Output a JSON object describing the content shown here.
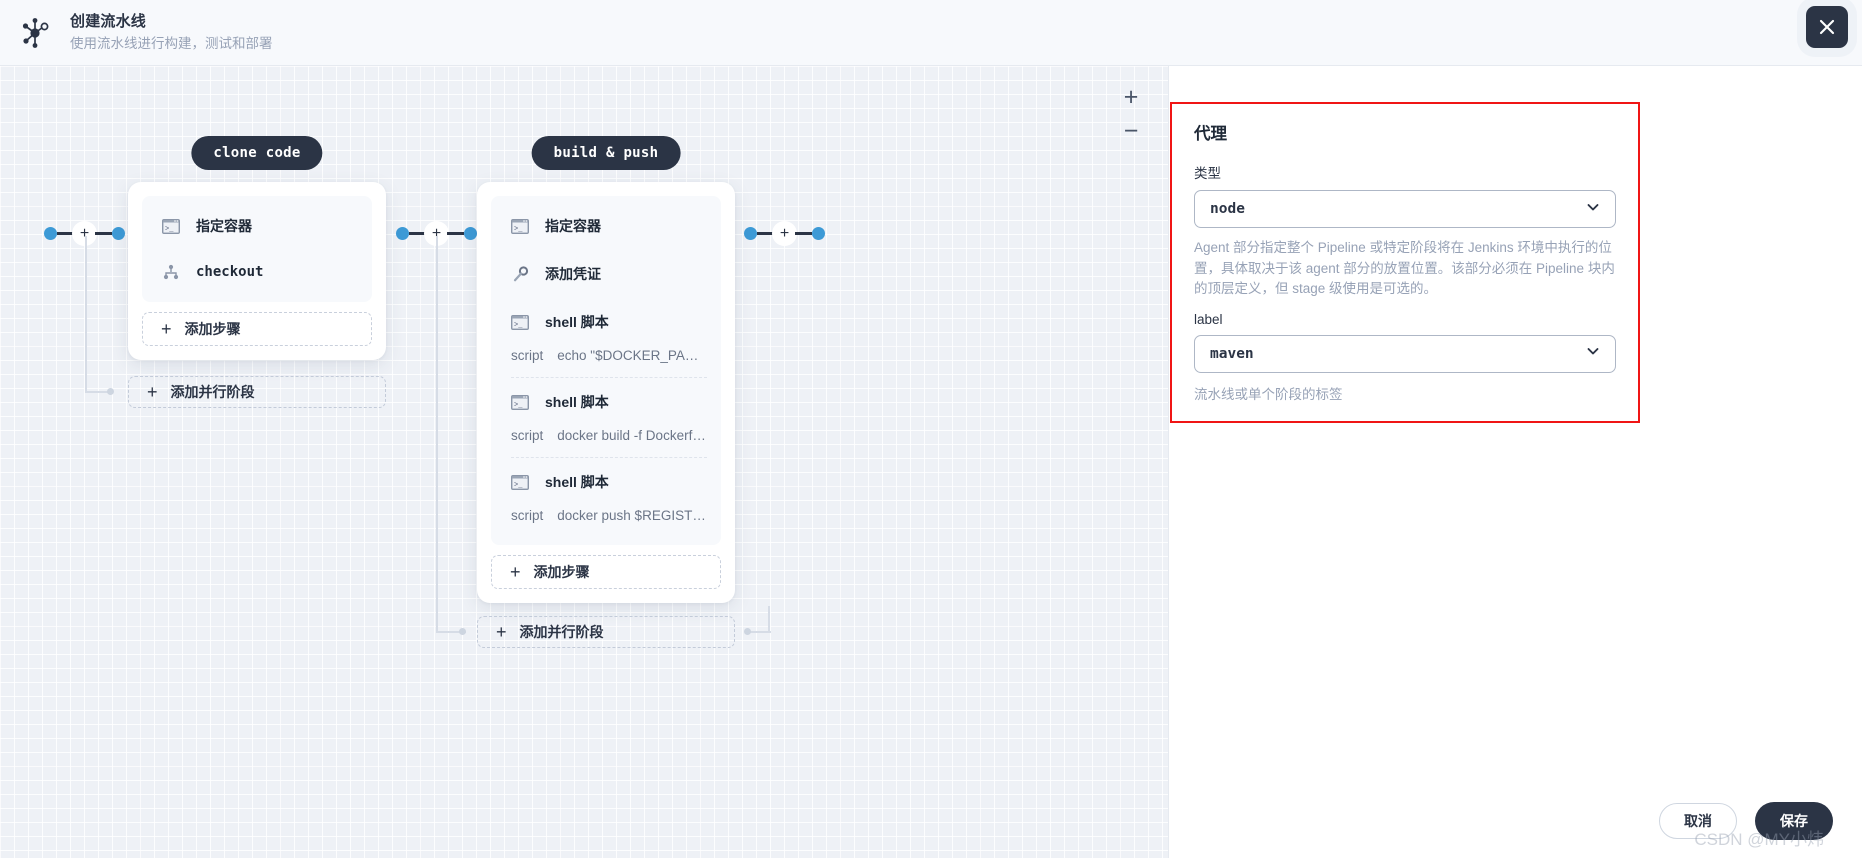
{
  "header": {
    "title": "创建流水线",
    "subtitle": "使用流水线进行构建，测试和部署",
    "logo_icon": "pipeline-node-graph-icon",
    "close_icon": "close-icon"
  },
  "canvas": {
    "zoom_in": "+",
    "zoom_out": "−",
    "stages": [
      {
        "name": "clone code",
        "steps": [
          {
            "icon": "terminal-icon",
            "label": "指定容器",
            "script_key": null,
            "script_value": null
          },
          {
            "icon": "checkout-branch-icon",
            "label": "checkout",
            "script_key": null,
            "script_value": null
          }
        ],
        "add_step_label": "添加步骤",
        "add_parallel_label": "添加并行阶段"
      },
      {
        "name": "build & push",
        "steps": [
          {
            "icon": "terminal-icon",
            "label": "指定容器",
            "script_key": null,
            "script_value": null
          },
          {
            "icon": "key-icon",
            "label": "添加凭证",
            "script_key": null,
            "script_value": null
          },
          {
            "icon": "terminal-icon",
            "label": "shell 脚本",
            "script_key": "script",
            "script_value": "echo \"$DOCKER_PASS…"
          },
          {
            "icon": "terminal-icon",
            "label": "shell 脚本",
            "script_key": "script",
            "script_value": "docker build -f Dockerfile…"
          },
          {
            "icon": "terminal-icon",
            "label": "shell 脚本",
            "script_key": "script",
            "script_value": "docker push $REGISTR…"
          }
        ],
        "add_step_label": "添加步骤",
        "add_parallel_label": "添加并行阶段"
      }
    ]
  },
  "panel": {
    "heading": "代理",
    "type_label": "类型",
    "type_value": "node",
    "type_help": "Agent 部分指定整个 Pipeline 或特定阶段将在 Jenkins 环境中执行的位置，具体取决于该 agent 部分的放置位置。该部分必须在 Pipeline 块内的顶层定义，但 stage 级使用是可选的。",
    "label_label": "label",
    "label_value": "maven",
    "label_help": "流水线或单个阶段的标签",
    "chevron_icon": "chevron-down-icon",
    "highlight_color": "#f01515"
  },
  "footer": {
    "cancel": "取消",
    "save": "保存"
  },
  "watermark": "CSDN @MY小炜"
}
